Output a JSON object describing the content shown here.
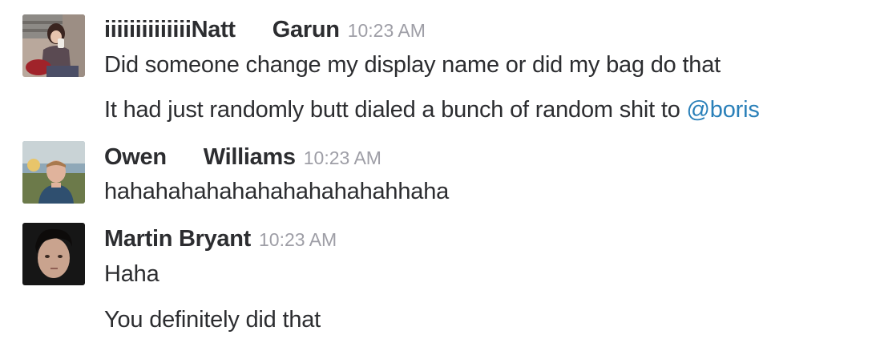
{
  "messages": [
    {
      "first_name": "iiiiiiiiiiiiiiNatt",
      "last_name": "Garun",
      "time": "10:23 AM",
      "lines": [
        {
          "text": "Did someone change my display name or did my bag do that"
        },
        {
          "text": "It had just randomly butt dialed a bunch of random shit to ",
          "mention": "@boris"
        }
      ]
    },
    {
      "first_name": "Owen",
      "last_name": "Williams",
      "time": "10:23 AM",
      "lines": [
        {
          "text": "hahahahahahahahahahahahhaha"
        }
      ]
    },
    {
      "name": "Martin Bryant",
      "time": "10:23 AM",
      "lines": [
        {
          "text": "Haha"
        },
        {
          "text": "You definitely did that"
        }
      ]
    }
  ],
  "colors": {
    "text": "#2c2d30",
    "timestamp": "#9e9ea6",
    "mention": "#2a80b9"
  }
}
